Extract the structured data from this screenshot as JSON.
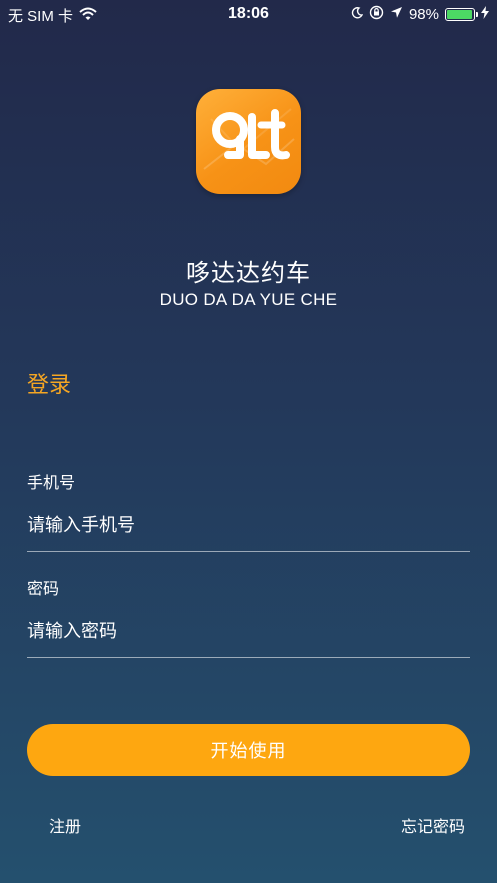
{
  "status_bar": {
    "carrier": "无 SIM 卡",
    "time": "18:06",
    "battery_percent": "98%",
    "battery_level": 0.98,
    "icons": [
      "wifi-icon",
      "moon-icon",
      "orientation-lock-icon",
      "location-arrow-icon",
      "charging-bolt-icon"
    ],
    "battery_color": "#4cd964"
  },
  "app": {
    "title": "哆达达约车",
    "subtitle": "DUO DA DA YUE CHE",
    "icon_color": "#f79216"
  },
  "login": {
    "heading": "登录",
    "heading_color": "#f5a623",
    "phone_label": "手机号",
    "phone_placeholder": "请输入手机号",
    "password_label": "密码",
    "password_placeholder": "请输入密码",
    "submit_label": "开始使用",
    "submit_color": "#fea710",
    "register_label": "注册",
    "forgot_label": "忘记密码"
  }
}
